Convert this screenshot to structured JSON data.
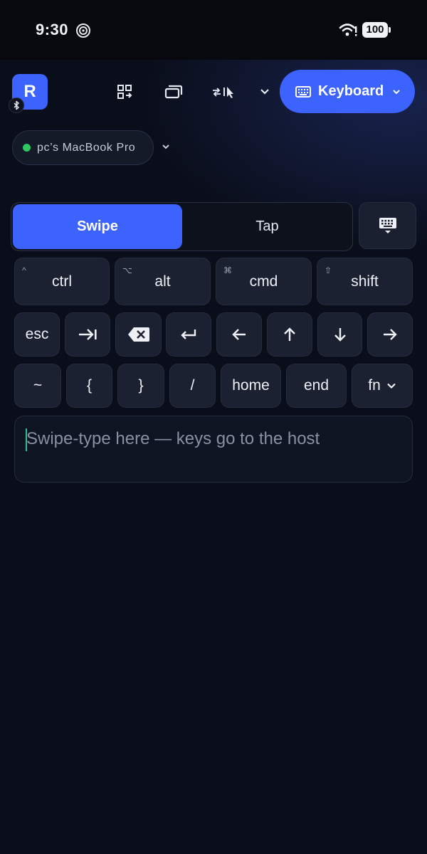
{
  "status_bar": {
    "time": "9:30",
    "battery": "100",
    "icons": [
      "hotspot-icon",
      "wifi-icon",
      "battery-icon"
    ]
  },
  "toolbar": {
    "logo_letter": "R",
    "icons": [
      "bluetooth-icon",
      "qr-scan-icon",
      "windows-icon",
      "swap-cursor-icon",
      "chevron-down-icon"
    ],
    "mode_label": "Keyboard",
    "accent": "#3d63ff"
  },
  "device": {
    "name": "pc’s MacBook Pro",
    "status_color": "#2ec760"
  },
  "input_mode": {
    "options": [
      "Swipe",
      "Tap"
    ],
    "selected": "Swipe"
  },
  "keys": {
    "modifiers": [
      {
        "label": "ctrl",
        "symbol": "^"
      },
      {
        "label": "alt",
        "symbol": "⌥"
      },
      {
        "label": "cmd",
        "symbol": "⌘"
      },
      {
        "label": "shift",
        "symbol": "⇧"
      }
    ],
    "row2": {
      "esc": "esc"
    },
    "row3": {
      "tilde": "~",
      "lbrace": "{",
      "rbrace": "}",
      "slash": "/",
      "home": "home",
      "end": "end",
      "fn": "fn"
    }
  },
  "swipe_input": {
    "placeholder": "Swipe-type here — keys go to the host"
  }
}
